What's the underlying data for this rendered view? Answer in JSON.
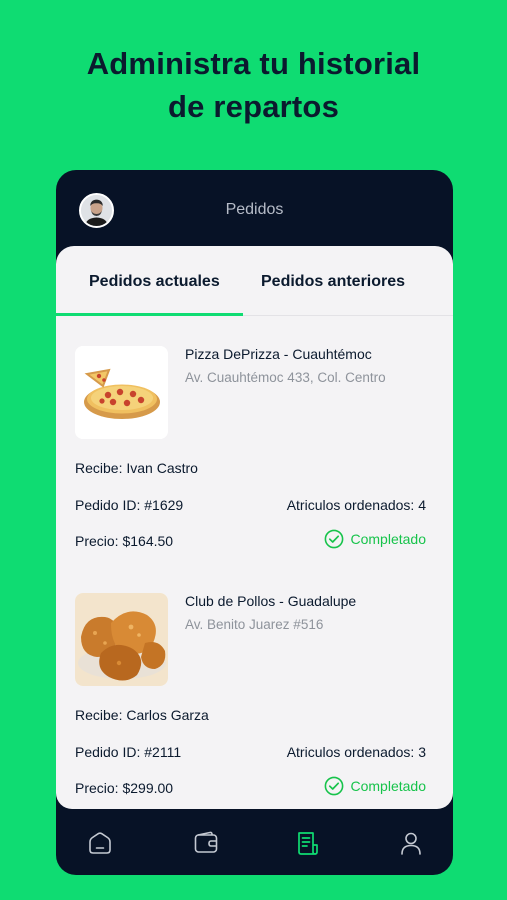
{
  "headline": {
    "line1": "Administra tu historial",
    "line2": "de repartos"
  },
  "screen": {
    "title": "Pedidos"
  },
  "tabs": [
    {
      "label": "Pedidos actuales",
      "active": true
    },
    {
      "label": "Pedidos anteriores",
      "active": false
    }
  ],
  "orders": [
    {
      "restaurant": "Pizza DePrizza - Cuauhtémoc",
      "address": "Av. Cuauhtémoc 433, Col. Centro",
      "recipient": "Recibe: Ivan Castro",
      "order_id": "Pedido ID: #1629",
      "items": "Atriculos ordenados: 4",
      "price": "Precio: $164.50",
      "status": "Completado",
      "image": "pizza-image"
    },
    {
      "restaurant": "Club de Pollos - Guadalupe",
      "address": "Av. Benito Juarez #516",
      "recipient": "Recibe: Carlos Garza",
      "order_id": "Pedido ID: #2111",
      "items": "Atriculos ordenados: 3",
      "price": "Precio: $299.00",
      "status": "Completado",
      "image": "fried-chicken-image"
    }
  ],
  "nav": [
    {
      "icon": "home-icon",
      "active": false
    },
    {
      "icon": "wallet-icon",
      "active": false
    },
    {
      "icon": "orders-icon",
      "active": true
    },
    {
      "icon": "profile-icon",
      "active": false
    }
  ],
  "colors": {
    "background": "#0fdc72",
    "phone": "#071226",
    "accent": "#0fdc72",
    "status": "#17c34b",
    "text": "#0b1a2e"
  }
}
